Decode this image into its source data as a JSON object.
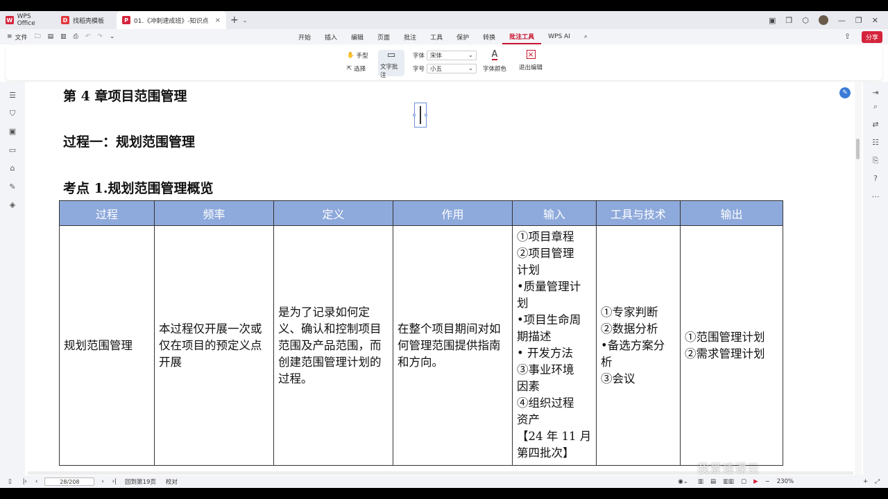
{
  "tabs": {
    "home": "WPS Office",
    "t2": "找稻壳模板",
    "t3": "01.《冲刺速成班》-知识点"
  },
  "menu": {
    "file": "文件",
    "items": [
      "开始",
      "插入",
      "编辑",
      "页面",
      "批注",
      "工具",
      "保护",
      "转换",
      "批注工具",
      "WPS AI"
    ],
    "share": "分享"
  },
  "toolbar": {
    "hand": "手型",
    "select": "选择",
    "text_comment": "文字批注",
    "font_label": "字体",
    "font_value": "宋体",
    "size_label": "字号",
    "size_value": "小五",
    "font_color": "字体颜色",
    "exit_edit": "退出编辑"
  },
  "doc": {
    "chapter": "第 4 章项目范围管理",
    "process": "过程一：规划范围管理",
    "point": "考点 1.规划范围管理概览",
    "table": {
      "headers": [
        "过程",
        "频率",
        "定义",
        "作用",
        "输入",
        "工具与技术",
        "输出"
      ],
      "row": {
        "process": "规划范围管理",
        "frequency": "本过程仅开展一次或仅在项目的预定义点开展",
        "definition": "是为了记录如何定义、确认和控制项目范围及产品范围，而创建范围管理计划的过程。",
        "role": "在整个项目期间对如何管理范围提供指南和方向。",
        "inputs": [
          "①项目章程",
          "②项目管理",
          "计划",
          "•质量管理计",
          "划",
          "•项目生命周",
          "期描述",
          "• 开发方法",
          "③事业环境",
          "因素",
          "④组织过程",
          "资产",
          "【24 年 11 月",
          "第四批次】"
        ],
        "tools": [
          "①专家判断",
          "②数据分析",
          "•备选方案分",
          "析",
          "③会议"
        ],
        "outputs": [
          "①范围管理计划",
          "②需求管理计划"
        ]
      }
    }
  },
  "status": {
    "page": "28/208",
    "goto": "回到第19页",
    "proof": "校对",
    "zoom": "230%"
  },
  "watermark": "我爱速课云",
  "colors": {
    "header_fill": "#8ea9db",
    "accent": "#c8102e"
  }
}
